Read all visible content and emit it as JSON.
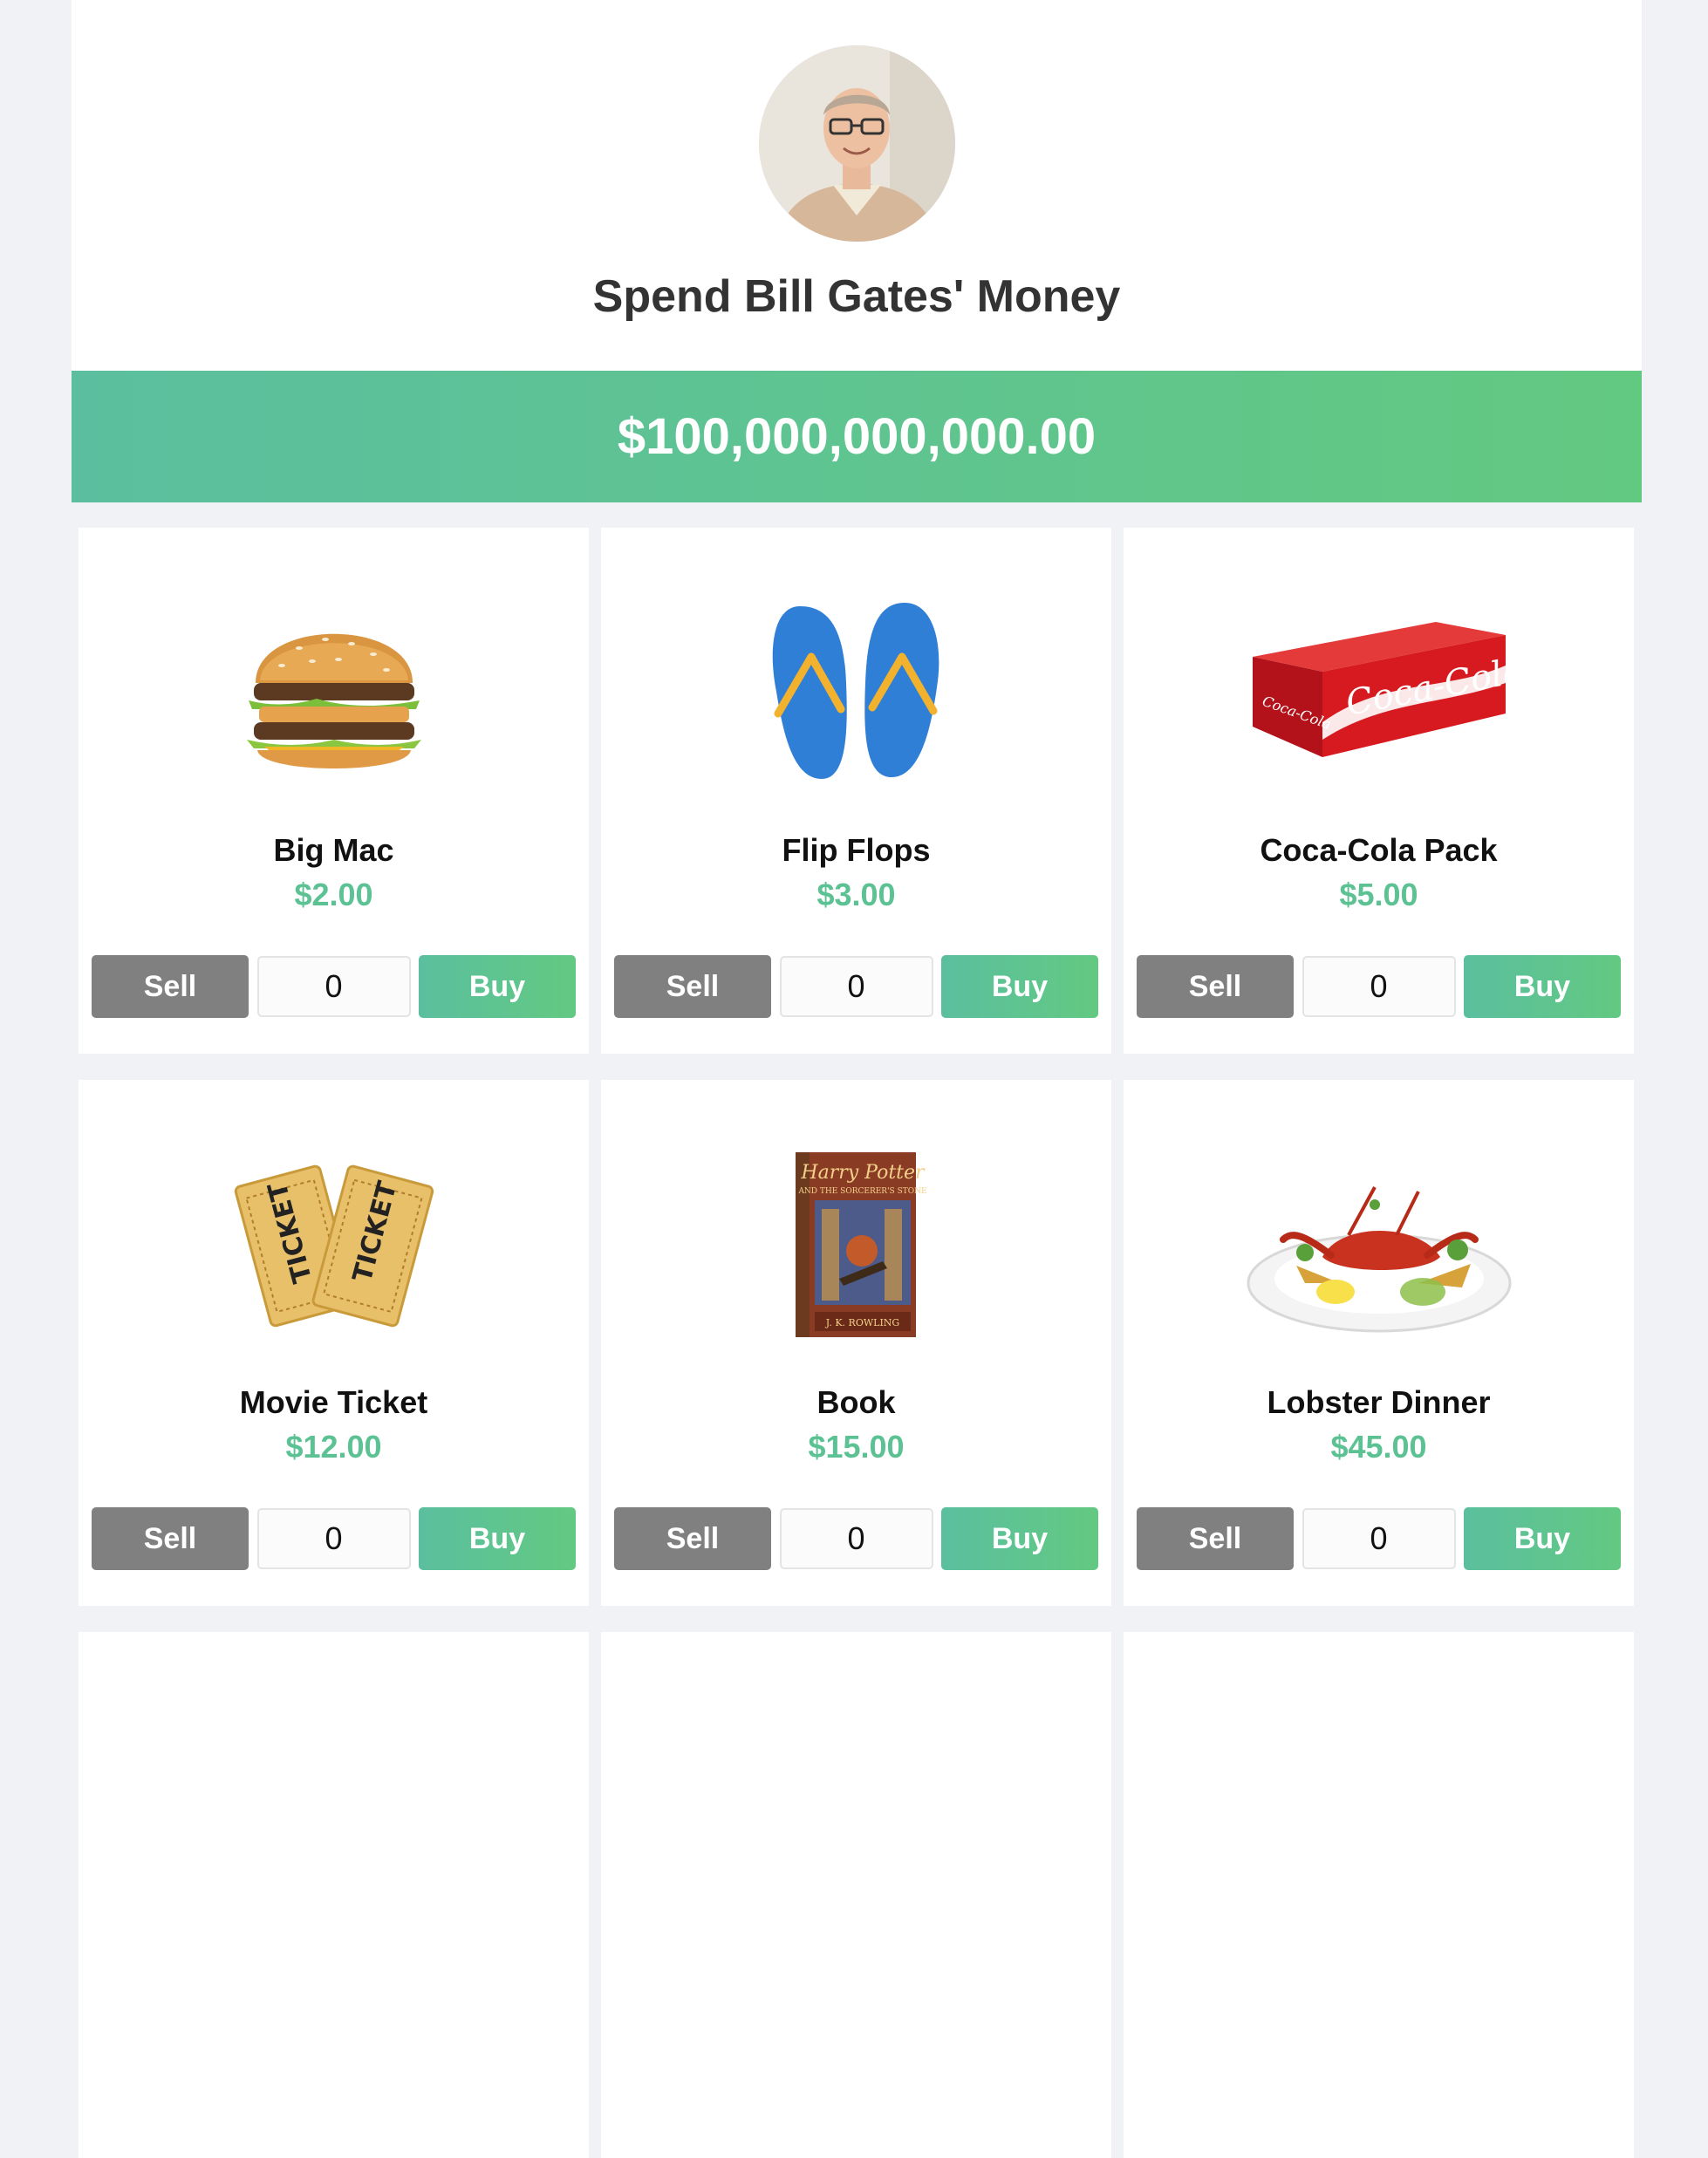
{
  "header": {
    "title": "Spend Bill Gates' Money",
    "avatar_icon": "person-portrait"
  },
  "balance": "$100,000,000,000.00",
  "colors": {
    "accent_green": "#5cc293",
    "sell_gray": "#808080",
    "background": "#f1f2f6"
  },
  "products": [
    {
      "name": "Big Mac",
      "price": "$2.00",
      "quantity": "0",
      "sell_label": "Sell",
      "buy_label": "Buy",
      "image": "burger-image"
    },
    {
      "name": "Flip Flops",
      "price": "$3.00",
      "quantity": "0",
      "sell_label": "Sell",
      "buy_label": "Buy",
      "image": "flip-flops-image"
    },
    {
      "name": "Coca-Cola Pack",
      "price": "$5.00",
      "quantity": "0",
      "sell_label": "Sell",
      "buy_label": "Buy",
      "image": "soda-pack-image"
    },
    {
      "name": "Movie Ticket",
      "price": "$12.00",
      "quantity": "0",
      "sell_label": "Sell",
      "buy_label": "Buy",
      "image": "ticket-image"
    },
    {
      "name": "Book",
      "price": "$15.00",
      "quantity": "0",
      "sell_label": "Sell",
      "buy_label": "Buy",
      "image": "book-image"
    },
    {
      "name": "Lobster Dinner",
      "price": "$45.00",
      "quantity": "0",
      "sell_label": "Sell",
      "buy_label": "Buy",
      "image": "lobster-image"
    }
  ]
}
